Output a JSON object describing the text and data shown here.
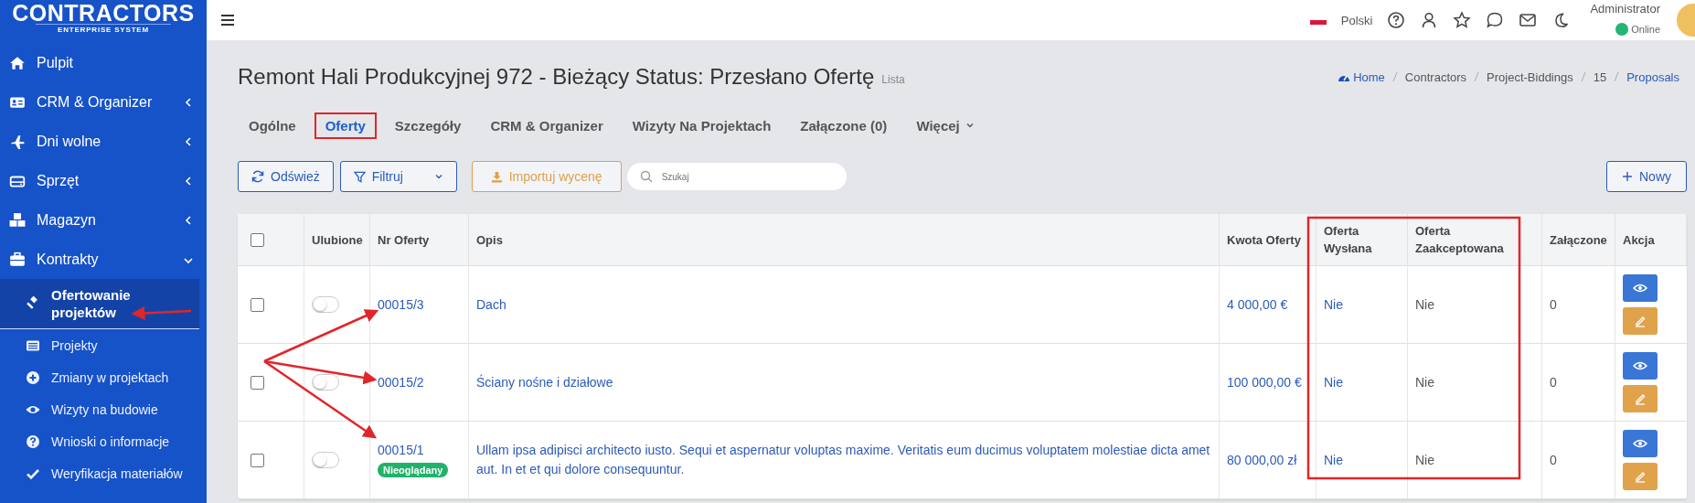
{
  "sidebar": {
    "logo": {
      "title": "CONTRACTORS",
      "subtitle": "ENTERPRISE SYSTEM"
    },
    "items": [
      {
        "label": "Pulpit",
        "kind": "link",
        "selected": false
      },
      {
        "label": "CRM & Organizer",
        "kind": "group",
        "expanded": false,
        "selected": false
      },
      {
        "label": "Dni wolne",
        "kind": "group",
        "expanded": false,
        "selected": false
      },
      {
        "label": "Sprzęt",
        "kind": "group",
        "expanded": false,
        "selected": false
      },
      {
        "label": "Magazyn",
        "kind": "group",
        "expanded": false,
        "selected": false
      },
      {
        "label": "Kontrakty",
        "kind": "group",
        "expanded": true,
        "selected": false,
        "children": [
          {
            "label": "Ofertowanie projektów",
            "selected": true
          },
          {
            "label": "Projekty",
            "selected": false
          },
          {
            "label": "Zmiany w projektach",
            "selected": false
          },
          {
            "label": "Wizyty na budowie",
            "selected": false
          },
          {
            "label": "Wnioski o informacje",
            "selected": false
          },
          {
            "label": "Weryfikacja materiałów",
            "selected": false
          }
        ]
      }
    ]
  },
  "topbar": {
    "language": "Polski",
    "user": {
      "name": "Administrator",
      "status": "Online"
    }
  },
  "header": {
    "title": "Remont Hali Produkcyjnej 972 - Bieżący Status: Przesłano Ofertę",
    "subtitle": "Lista",
    "breadcrumbs": [
      {
        "label": "Home",
        "link": true
      },
      {
        "label": "Contractors",
        "link": false
      },
      {
        "label": "Project-Biddings",
        "link": false
      },
      {
        "label": "15",
        "link": false
      },
      {
        "label": "Proposals",
        "link": true
      }
    ]
  },
  "tabs": [
    {
      "label": "Ogólne",
      "selected": false
    },
    {
      "label": "Oferty",
      "selected": true
    },
    {
      "label": "Szczegóły",
      "selected": false
    },
    {
      "label": "CRM & Organizer",
      "selected": false
    },
    {
      "label": "Wizyty Na Projektach",
      "selected": false
    },
    {
      "label": "Załączone (0)",
      "selected": false
    },
    {
      "label": "Więcej",
      "selected": false,
      "dropdown": true
    }
  ],
  "toolbar": {
    "refresh": "Odśwież",
    "filter": "Filtruj",
    "import": "Importuj wycenę",
    "search": {
      "placeholder": "Szukaj"
    },
    "new": "Nowy"
  },
  "table": {
    "select_all_checked": false,
    "columns": [
      "Ulubione",
      "Nr Oferty",
      "Opis",
      "Kwota Oferty",
      "Oferta Wysłana",
      "Oferta Zaakceptowana",
      "Załączone",
      "Akcja"
    ],
    "rows": [
      {
        "checked": false,
        "favorite": false,
        "number": "00015/3",
        "description": "Dach",
        "amount": "4 000,00 €",
        "sent": "Nie",
        "accepted": "Nie",
        "attachments": "0"
      },
      {
        "checked": false,
        "favorite": false,
        "number": "00015/2",
        "description": "Ściany nośne i działowe",
        "amount": "100 000,00 €",
        "sent": "Nie",
        "accepted": "Nie",
        "attachments": "0"
      },
      {
        "checked": false,
        "favorite": false,
        "number": "00015/1",
        "badge": "Nieoglądany",
        "description": "Ullam ipsa adipisci architecto iusto. Sequi et aspernatur voluptas maxime. Veritatis eum ducimus voluptatem molestiae dicta amet aut. In et et qui dolore consequuntur.",
        "amount": "80 000,00 zł",
        "sent": "Nie",
        "accepted": "Nie",
        "attachments": "0"
      }
    ]
  }
}
